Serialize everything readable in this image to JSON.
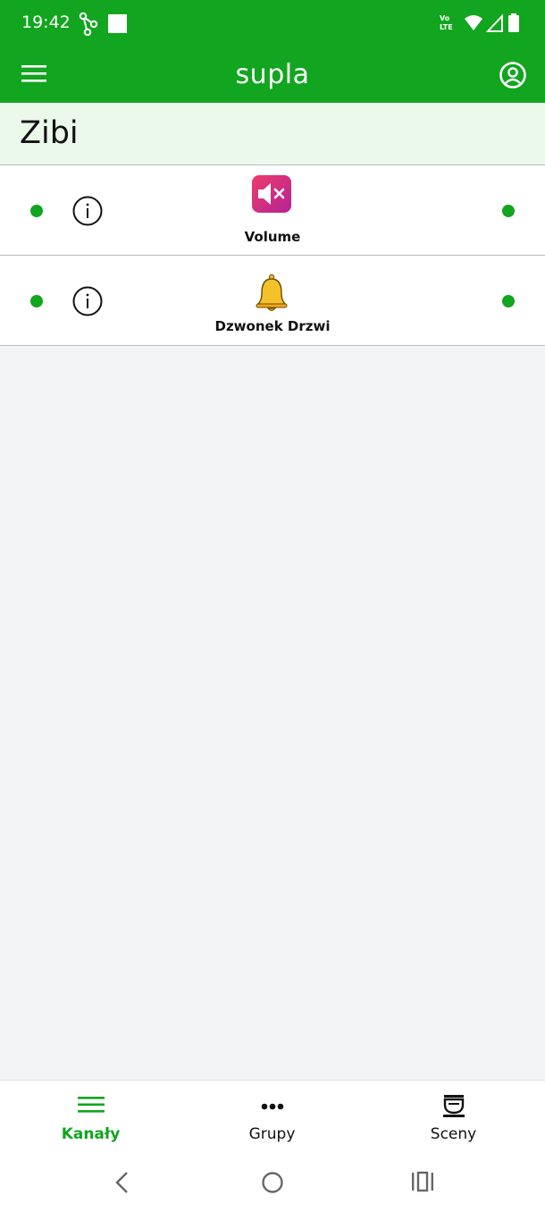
{
  "status_bar": {
    "time": "19:42",
    "left_icons": [
      "share-nodes-icon",
      "square-notification-icon"
    ],
    "right_icons": [
      "volte-icon",
      "wifi-icon",
      "cell-signal-icon",
      "battery-icon"
    ]
  },
  "app_bar": {
    "title": "supla",
    "menu_icon": "hamburger-menu-icon",
    "account_icon": "account-circle-icon"
  },
  "location": {
    "name": "Zibi"
  },
  "channels": [
    {
      "caption": "Volume",
      "icon": "speaker-mute-icon",
      "left_status": "online",
      "right_status": "online"
    },
    {
      "caption": "Dzwonek Drzwi",
      "icon": "bell-icon",
      "left_status": "online",
      "right_status": "online"
    }
  ],
  "bottom_nav": {
    "items": [
      {
        "label": "Kanały",
        "icon": "list-icon",
        "active": true
      },
      {
        "label": "Grupy",
        "icon": "dots-icon",
        "active": false
      },
      {
        "label": "Sceny",
        "icon": "cup-icon",
        "active": false
      }
    ]
  },
  "system_nav": [
    "back-icon",
    "home-icon",
    "recents-icon"
  ],
  "colors": {
    "primary": "#12a51f",
    "location_bg": "#eaf9ea",
    "page_bg": "#f3f4f6",
    "volume_icon": "#e0307a",
    "bell_icon": "#f5c12b"
  }
}
